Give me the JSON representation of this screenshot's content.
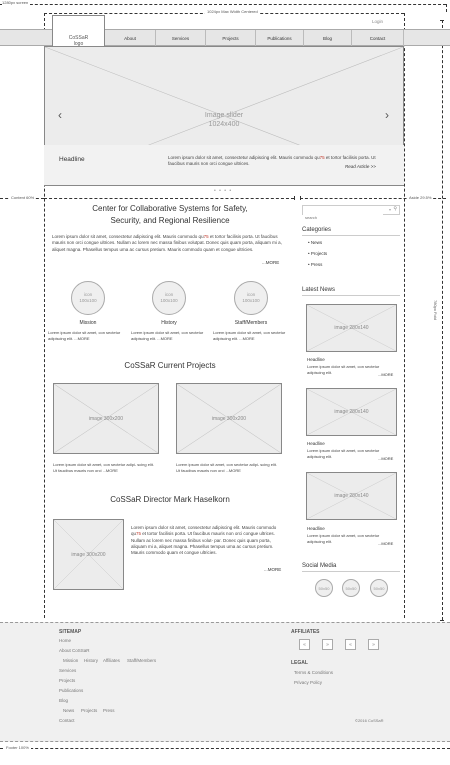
{
  "annotations": {
    "screen_width": "1280px screen",
    "max_width": "1024px Max Width Centered",
    "content": "Content 60%",
    "aside": "Aside 29.5%",
    "height": "780px Fold",
    "footer": "Footer 100%"
  },
  "header": {
    "login": "Login",
    "logo_line1": "CoSSaR",
    "logo_line2": "logo",
    "nav": [
      "About",
      "Services",
      "Projects",
      "Publications",
      "Blog",
      "Contact"
    ]
  },
  "slider": {
    "label_line1": "Image slider",
    "label_line2": "1024x400",
    "headline": "Headline",
    "text_before": "Lorem ipsum dolor sit amet, consectetur adipiscing elit. Mauris commodo qu",
    "text_red": "75",
    "text_after": " et tortor facilisis porta. Ut faucibus mauris non orci congue ultrices.",
    "read_more": "Read Article >>",
    "dots": "• • • •"
  },
  "main": {
    "title_line1": "Center for Collaborative Systems for Safety,",
    "title_line2": "Security, and Regional Resilience",
    "intro_before": "Lorem ipsum dolor sit amet, consectetur adipiscing elit. Mauris commodo qu",
    "intro_red": "75",
    "intro_after": " et tortor facilisis porta. Ut faucibus mauris non orci congue ultrices. Nullam ac lorem nec massa finibus volutpat. Donec quis quam porta, aliquam mi a, aliquet magna. Phasellus tempus uma ac cursus pretium. Mauris commodo quam et congue ultricies.",
    "intro_more": "...MORE",
    "icons": [
      {
        "icon": "icon",
        "size": "100x100",
        "title": "Mission",
        "text": "Lorem ipsum dolor sit amet, con sectetur adipiscing elit.",
        "more": "...MORE"
      },
      {
        "icon": "icon",
        "size": "100x100",
        "title": "History",
        "text": "Lorem ipsum dolor sit amet, con sectetur adipiscing elit.",
        "more": "...MORE"
      },
      {
        "icon": "icon",
        "size": "100x100",
        "title": "Staff/Members",
        "text": "Lorem ipsum dolor sit amet, con sectetur adipiscing elit.",
        "more": "...MORE"
      }
    ],
    "projects_title": "CoSSaR Current Projects",
    "projects": [
      {
        "image": "image 300x200",
        "text": "Lorem ipsum dolor sit amet, con sectetur adipi- scing elit. Ut faucibus mauris non orci ...",
        "more": "MORE"
      },
      {
        "image": "image 300x200",
        "text": "Lorem ipsum dolor sit amet, con sectetur adipi- scing elit. Ut faucibus mauris non orci ...",
        "more": "MORE"
      }
    ],
    "director_title": "CoSSaR Director Mark Haselkorn",
    "director_image": "image 300x200",
    "director_before": "Lorem ipsum dolor sit amet, consectetur adipiscing elit. Mauris commodo qu",
    "director_red": "75",
    "director_after": " et tortor facilisis porta. Ut faucibus mauris non orci congue ultrices. Nullam ac lorem nec massa finibus volut- par. Donec quis quam porta, aliquam mi a, aliquet magna. Phasellus tempus uma ac cursus pretium. Mauris commodo quam et congue ultricies.",
    "director_more": "...MORE"
  },
  "aside": {
    "search_placeholder": "search",
    "categories_title": "Categories",
    "categories": [
      "News",
      "Projects",
      "Press"
    ],
    "news_title": "Latest News",
    "news": [
      {
        "image": "image 280x140",
        "headline": "Headline",
        "text": "Lorem ipsum dolor sit amet, con sectetur adipiscing elit.",
        "more": "...MORE"
      },
      {
        "image": "image 280x140",
        "headline": "Headline",
        "text": "Lorem ipsum dolor sit amet, con sectetur adipiscing elit.",
        "more": "...MORE"
      },
      {
        "image": "image 280x140",
        "headline": "Headline",
        "text": "Lorem ipsum dolor sit amet, con sectetur adipiscing elit.",
        "more": "...MORE"
      }
    ],
    "social_title": "Social Media",
    "social": [
      "50x50",
      "50x50",
      "50x50"
    ]
  },
  "footer": {
    "sitemap_title": "SITEMAP",
    "sitemap": [
      "Home",
      "About CoSSaR",
      "Services",
      "Projects",
      "Publications",
      "Blog",
      "Contact"
    ],
    "about_sub": [
      "Mission",
      "History",
      "Affiliates",
      "Staff/Members"
    ],
    "blog_sub": [
      "News",
      "Projects",
      "Press"
    ],
    "affiliates_title": "AFFILIATES",
    "affiliates": [
      "«",
      "»",
      "«",
      "»"
    ],
    "legal_title": "LEGAL",
    "legal": [
      "Terms & Conditions",
      "Privacy Policy"
    ],
    "copyright": "©2016 CoSSaR"
  }
}
